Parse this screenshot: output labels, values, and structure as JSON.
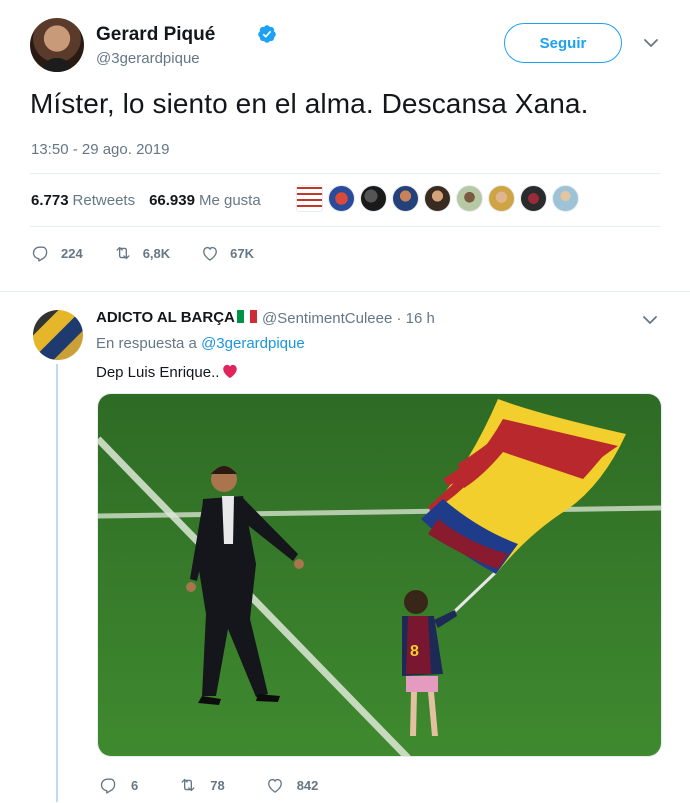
{
  "tweet": {
    "display_name": "Gerard Piqué",
    "handle": "@3gerardpique",
    "follow_label": "Seguir",
    "text": "Míster, lo siento en el alma. Descansa Xana.",
    "timestamp": "13:50 - 29 ago. 2019",
    "retweets_count": "6.773",
    "retweets_label": "Retweets",
    "likes_count": "66.939",
    "likes_label": "Me gusta",
    "actions": {
      "replies": "224",
      "retweets": "6,8K",
      "likes": "67K"
    }
  },
  "reply": {
    "display_name": "ADICTO AL BARÇA",
    "handle": "@SentimentCuleee · 16 h",
    "in_reply_prefix": "En respuesta a ",
    "in_reply_handle": "@3gerardpique",
    "text": "Dep Luis Enrique..",
    "actions": {
      "replies": "6",
      "retweets": "78",
      "likes": "842"
    }
  },
  "colors": {
    "accent": "#1da1f2",
    "muted": "#657786",
    "heart": "#e0245e"
  },
  "icons": [
    "verified-icon",
    "caret-icon",
    "reply-icon",
    "retweet-icon",
    "like-icon"
  ]
}
